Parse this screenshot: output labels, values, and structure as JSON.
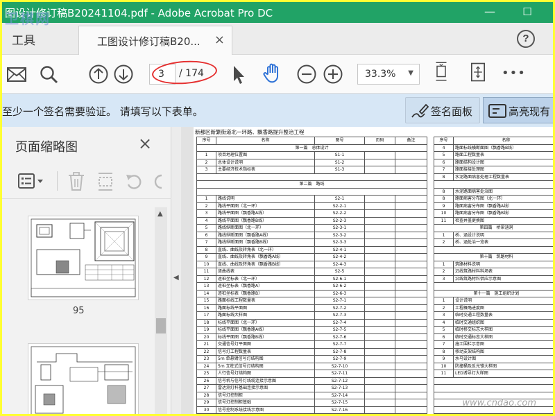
{
  "window": {
    "title": "图设计修订稿B20241104.pdf - Adobe Acrobat Pro DC",
    "minimize": "—",
    "maximize": "☐"
  },
  "tabs": {
    "tools": "工具",
    "document": "工图设计修订稿B20...",
    "close": "×",
    "help": "?"
  },
  "toolbar": {
    "page_current": "3",
    "page_total": "/ 174",
    "zoom": "33.3%",
    "zoom_caret": "▼",
    "more": "•••"
  },
  "signature_bar": {
    "message": "至少一个签名需要验证。 请填写以下表单。",
    "sign_panel": "签名面板",
    "highlight": "高亮现有"
  },
  "thumbnails": {
    "title": "页面缩略图",
    "close": "×",
    "page_label": "95"
  },
  "document": {
    "heading": "新都区新繁街道北一环路、飘香路提升整治工程",
    "left_headers": [
      "序号",
      "名称",
      "图号",
      "页码",
      "备注"
    ],
    "right_headers": [
      "序号",
      "名称"
    ],
    "left_rows": [
      {
        "section": "第一篇　总体设计"
      },
      {
        "cells": [
          "1",
          "项目地理位置图",
          "S1-1",
          "",
          ""
        ]
      },
      {
        "cells": [
          "2",
          "总体设计说明",
          "S1-2",
          "",
          ""
        ]
      },
      {
        "cells": [
          "3",
          "主要经济技术指标表",
          "S1-3",
          "",
          ""
        ]
      },
      {
        "section": ""
      },
      {
        "section": "第二篇　路线"
      },
      {
        "section": ""
      },
      {
        "cells": [
          "1",
          "路线说明",
          "S2-1",
          "",
          ""
        ]
      },
      {
        "cells": [
          "2",
          "路线平面图（北一环）",
          "S2-2-1",
          "",
          ""
        ]
      },
      {
        "cells": [
          "3",
          "路线平面图（飘香路A线）",
          "S2-2-2",
          "",
          ""
        ]
      },
      {
        "cells": [
          "4",
          "路线平面图（飘香路B线）",
          "S2-2-3",
          "",
          ""
        ]
      },
      {
        "cells": [
          "5",
          "路线纵断面图（北一环）",
          "S2-3-1",
          "",
          ""
        ]
      },
      {
        "cells": [
          "6",
          "路线纵断面图（飘香路A线）",
          "S2-3-2",
          "",
          ""
        ]
      },
      {
        "cells": [
          "7",
          "路线纵断面图（飘香路B线）",
          "S2-3-3",
          "",
          ""
        ]
      },
      {
        "cells": [
          "8",
          "直线、曲线及转角表（北一环）",
          "S2-4-1",
          "",
          ""
        ]
      },
      {
        "cells": [
          "9",
          "直线、曲线及转角表（飘香路A线）",
          "S2-4-2",
          "",
          ""
        ]
      },
      {
        "cells": [
          "10",
          "直线、曲线及转角表（飘香路B线）",
          "S2-4-3",
          "",
          ""
        ]
      },
      {
        "cells": [
          "11",
          "竖曲线表",
          "S2-5",
          "",
          ""
        ]
      },
      {
        "cells": [
          "12",
          "逐桩坐标表（北一环）",
          "S2-6-1",
          "",
          ""
        ]
      },
      {
        "cells": [
          "13",
          "逐桩坐标表（飘香路A）",
          "S2-6-2",
          "",
          ""
        ]
      },
      {
        "cells": [
          "14",
          "逐桩坐标表（飘香路B）",
          "S2-6-3",
          "",
          ""
        ]
      },
      {
        "cells": [
          "15",
          "路面标线工程数量表",
          "S2-7-1",
          "",
          ""
        ]
      },
      {
        "cells": [
          "16",
          "路面标线平面图",
          "S2-7-2",
          "",
          ""
        ]
      },
      {
        "cells": [
          "17",
          "路面标线大样图",
          "S2-7-3",
          "",
          ""
        ]
      },
      {
        "cells": [
          "18",
          "标线平面图（北一环）",
          "S2-7-4",
          "",
          ""
        ]
      },
      {
        "cells": [
          "19",
          "标线平面图（飘香路A线）",
          "S2-7-5",
          "",
          ""
        ]
      },
      {
        "cells": [
          "20",
          "标线平面图（飘香路B线）",
          "S2-7-6",
          "",
          ""
        ]
      },
      {
        "cells": [
          "21",
          "交通信号灯平面图",
          "S2-7-7",
          "",
          ""
        ]
      },
      {
        "cells": [
          "22",
          "信号灯工程数量表",
          "S2-7-8",
          "",
          ""
        ]
      },
      {
        "cells": [
          "23",
          "5m 单悬臂信号灯结构图",
          "S2-7-9",
          "",
          ""
        ]
      },
      {
        "cells": [
          "24",
          "5m 立柱式信号灯结构图",
          "S2-7-10",
          "",
          ""
        ]
      },
      {
        "cells": [
          "25",
          "人行信号灯结构图",
          "S2-7-11",
          "",
          ""
        ]
      },
      {
        "cells": [
          "26",
          "信号机与信号灯线缆连接示意图",
          "S2-7-12",
          "",
          ""
        ]
      },
      {
        "cells": [
          "27",
          "雷达测灯杆基础连接示意图",
          "S2-7-13",
          "",
          ""
        ]
      },
      {
        "cells": [
          "28",
          "信号灯控制柜",
          "S2-7-14",
          "",
          ""
        ]
      },
      {
        "cells": [
          "29",
          "信号灯控制柜基础",
          "S2-7-15",
          "",
          ""
        ]
      },
      {
        "cells": [
          "30",
          "信号控制系统接线示意图",
          "S2-7-16",
          "",
          ""
        ]
      },
      {
        "cells": [
          "31",
          "管井井盖设计图",
          "S2-7-17",
          "",
          ""
        ]
      },
      {
        "cells": [
          "32",
          "管道开挖工程数量表",
          "S2-7-18",
          "",
          ""
        ]
      }
    ],
    "right_rows": [
      {
        "cells": [
          "4",
          "路面标线横断面图（飘香路B线）"
        ]
      },
      {
        "cells": [
          "5",
          "路面工程数量表"
        ]
      },
      {
        "cells": [
          "6",
          "路面结构设计图"
        ]
      },
      {
        "cells": [
          "7",
          "路面接接处理图"
        ]
      },
      {
        "cells": [
          "8",
          "水泥路面病害处理工程数量表"
        ]
      },
      {
        "section": ""
      },
      {
        "cells": [
          "8",
          "水泥路面病害处治图"
        ]
      },
      {
        "cells": [
          "8",
          "路面病害分布图（北一环）"
        ]
      },
      {
        "cells": [
          "9",
          "路面病害分布图（飘香路A线）"
        ]
      },
      {
        "cells": [
          "10",
          "路面病害分布图（飘香路B线）"
        ]
      },
      {
        "cells": [
          "11",
          "检查井盖更换图"
        ]
      },
      {
        "section": "第四篇　桥梁涵洞"
      },
      {
        "cells": [
          "1",
          "桥、涵设计说明"
        ]
      },
      {
        "cells": [
          "2",
          "桥、涵处治一览表"
        ]
      },
      {
        "section": ""
      },
      {
        "section": "第十篇　筑路材料"
      },
      {
        "cells": [
          "1",
          "筑路材料说明"
        ]
      },
      {
        "cells": [
          "2",
          "沿线筑路材料料场表"
        ]
      },
      {
        "cells": [
          "3",
          "沿线筑路材料供应示意图"
        ]
      },
      {
        "section": ""
      },
      {
        "section": "第十一篇　施工组织计划"
      },
      {
        "cells": [
          "1",
          "设计说明"
        ]
      },
      {
        "cells": [
          "2",
          "工程概略进度图"
        ]
      },
      {
        "cells": [
          "3",
          "临时交通工程数量表"
        ]
      },
      {
        "cells": [
          "4",
          "临时交通组织图"
        ]
      },
      {
        "cells": [
          "5",
          "临时移交标志大样图"
        ]
      },
      {
        "cells": [
          "6",
          "临时交通标志大样图"
        ]
      },
      {
        "cells": [
          "7",
          "施工围栏示意图"
        ]
      },
      {
        "cells": [
          "8",
          "移动支架结构图"
        ]
      },
      {
        "cells": [
          "9",
          "水马设计图"
        ]
      },
      {
        "cells": [
          "10",
          "防撞桶及反光锥大样图"
        ]
      },
      {
        "cells": [
          "11",
          "LED诱导灯大样图"
        ]
      },
      {
        "section": ""
      },
      {
        "section": ""
      },
      {
        "section": ""
      },
      {
        "section": ""
      },
      {
        "section": ""
      },
      {
        "section": ""
      },
      {
        "section": ""
      }
    ]
  },
  "watermark": {
    "top": "卫棋网",
    "bottom": "www.cndao.com"
  },
  "colors": {
    "titlebar": "#21a366",
    "border_highlight": "#ffff33",
    "signature_bar": "#d7e7f6",
    "annotation": "#e53030"
  },
  "icons": [
    "envelope-icon",
    "search-icon",
    "arrow-up-circle-icon",
    "arrow-down-circle-icon",
    "pointer-icon",
    "hand-icon",
    "zoom-out-icon",
    "zoom-in-icon",
    "fit-page-icon",
    "fullscreen-icon",
    "more-icon",
    "pen-sign-icon",
    "form-field-icon",
    "list-options-icon",
    "trash-icon",
    "crop-icon",
    "rotate-ccw-icon",
    "rotate-cw-icon"
  ]
}
